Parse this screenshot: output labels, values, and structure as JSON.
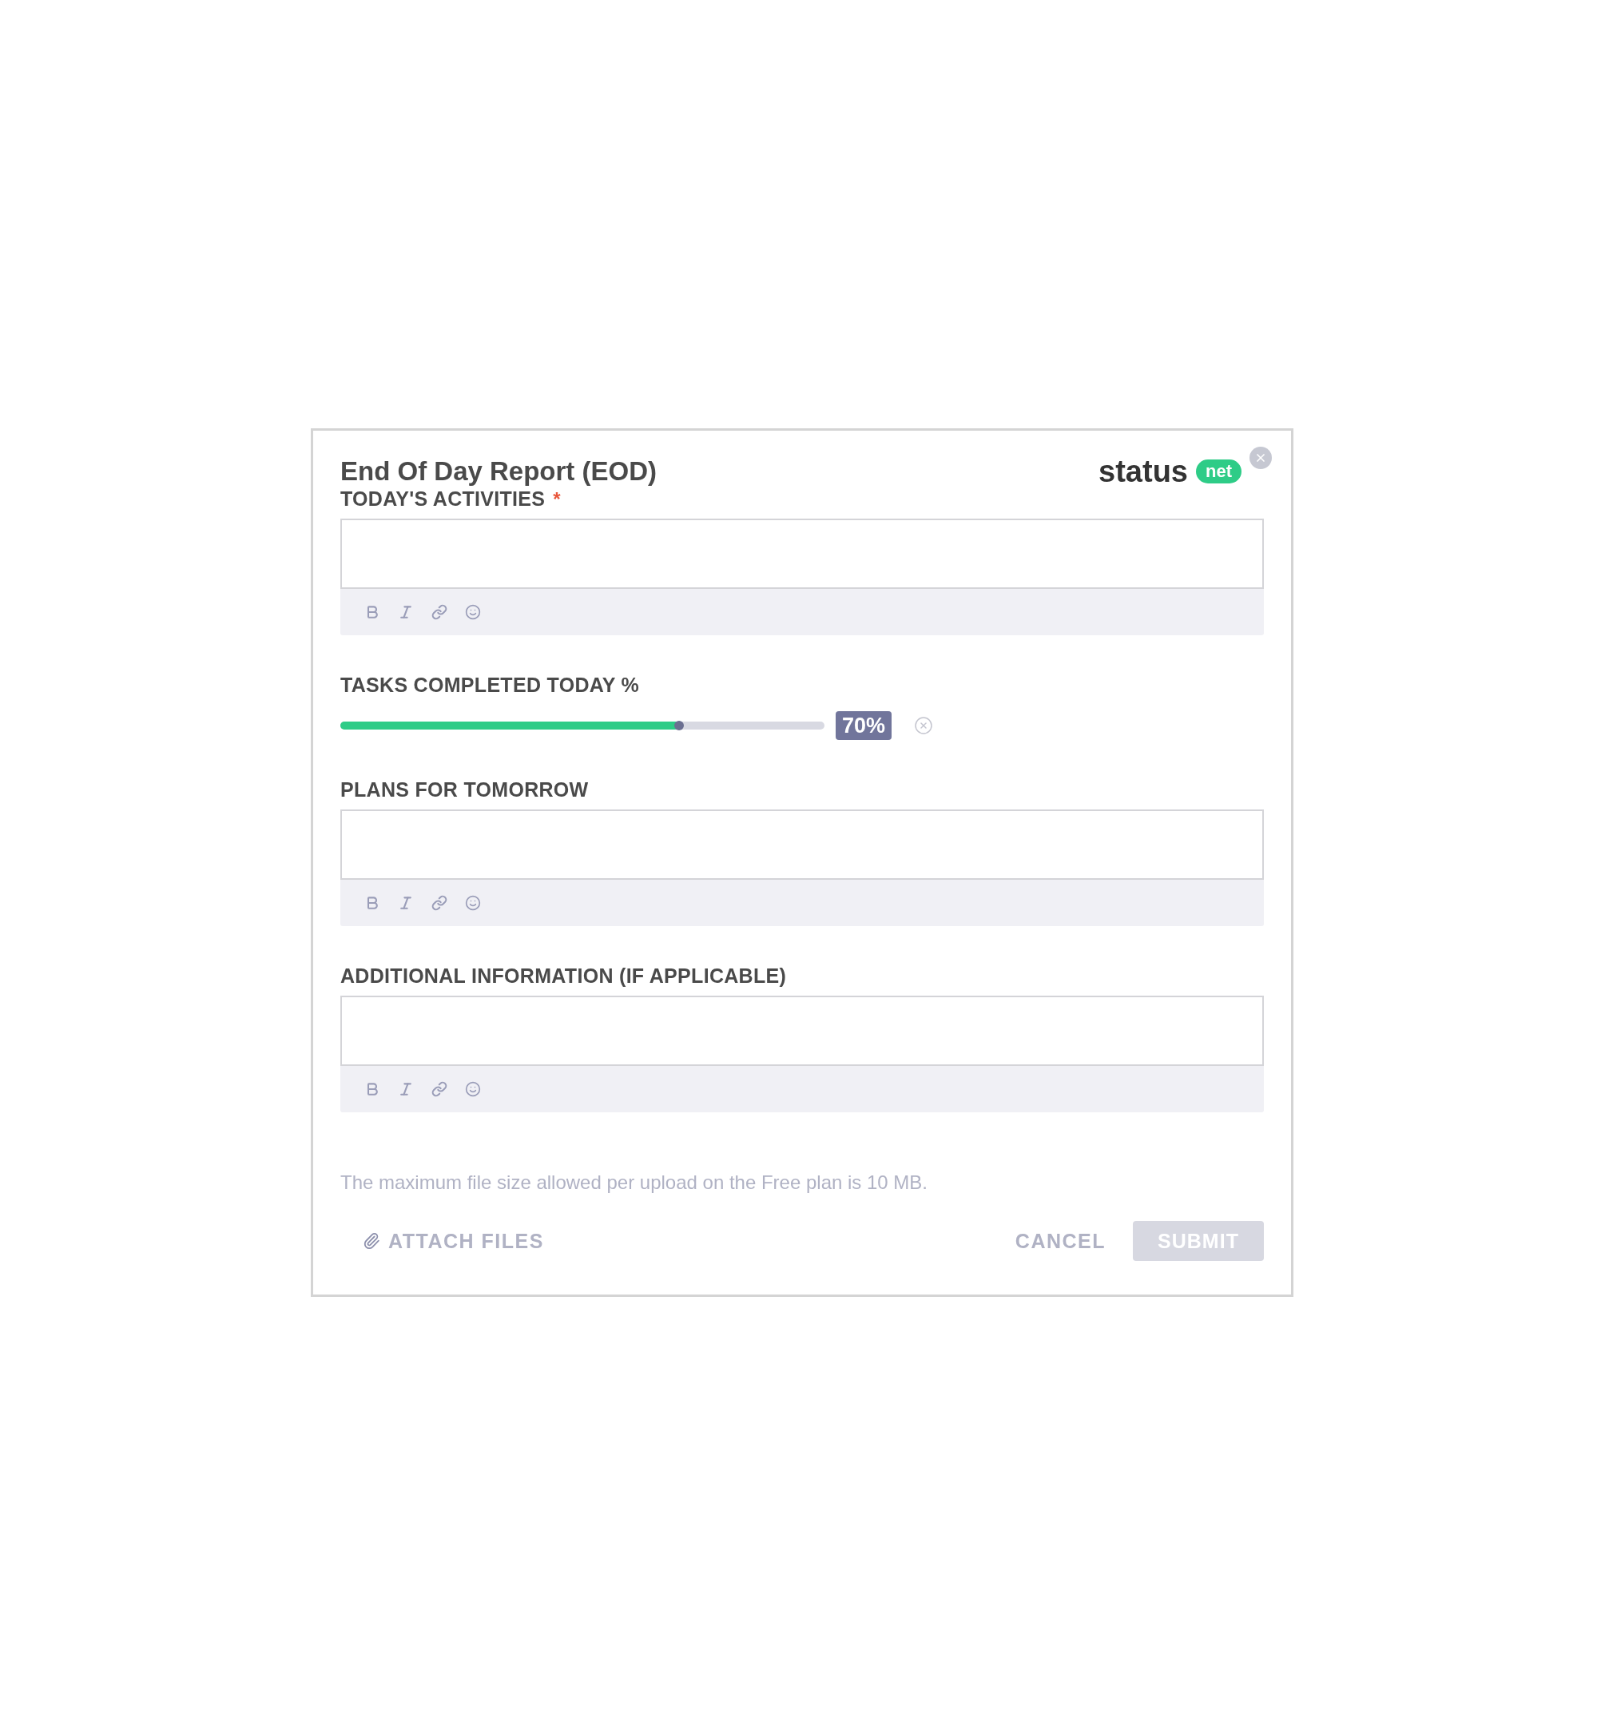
{
  "dialog": {
    "title": "End Of Day Report (EOD)",
    "logo": {
      "word": "status",
      "badge": "net"
    }
  },
  "fields": [
    {
      "kind": "richtext",
      "label": "TODAY'S ACTIVITIES",
      "required_mark": "*"
    },
    {
      "kind": "slider",
      "label": "TASKS COMPLETED TODAY %",
      "level": 0.7,
      "reading": "70%"
    },
    {
      "kind": "richtext",
      "label": "PLANS FOR TOMORROW"
    },
    {
      "kind": "richtext",
      "label": "ADDITIONAL INFORMATION (IF APPLICABLE)"
    }
  ],
  "note": "The maximum file size allowed per upload on the Free plan is 10 MB.",
  "footer": {
    "attach": "ATTACH FILES",
    "cancel": "CANCEL",
    "submit": {
      "label": "SUBMIT",
      "disabled": true
    }
  }
}
